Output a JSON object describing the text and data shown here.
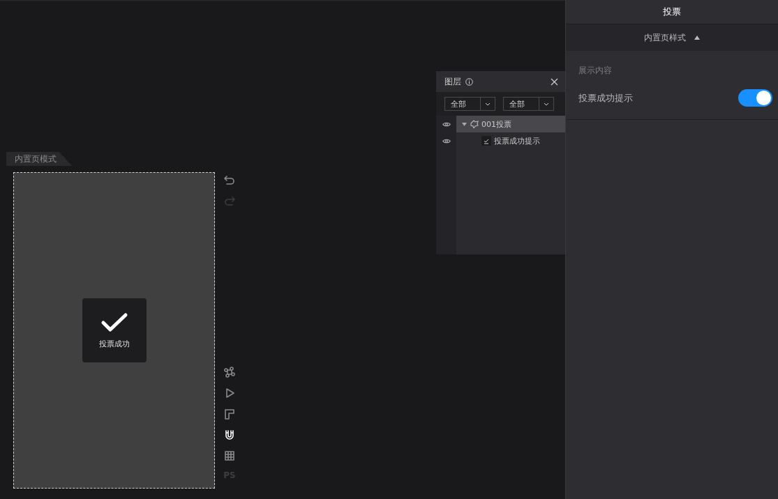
{
  "canvas": {
    "mode_tab": "内置页模式",
    "toast": {
      "text": "投票成功"
    },
    "toolbar": [
      {
        "disabled": false
      },
      {
        "disabled": true
      }
    ],
    "tools": [
      {
        "kind": "icon",
        "active": false
      },
      {
        "kind": "icon",
        "active": false
      },
      {
        "kind": "icon",
        "active": false
      },
      {
        "kind": "icon",
        "active": true
      },
      {
        "kind": "icon",
        "active": false
      },
      {
        "kind": "text",
        "label": "PS",
        "active": false
      }
    ]
  },
  "layers_panel": {
    "title": "图层",
    "filters": [
      "全部",
      "全部"
    ],
    "layers": [
      {
        "name": "001投票",
        "selected": true,
        "expanded": true,
        "visible": true,
        "children": [
          {
            "name": "投票成功提示",
            "selected": false,
            "visible": true
          }
        ]
      }
    ]
  },
  "properties": {
    "title": "投票",
    "section": {
      "title": "内置页样式",
      "expanded": true
    },
    "group_label": "展示内容",
    "settings": [
      {
        "label": "投票成功提示",
        "on": true
      }
    ]
  }
}
